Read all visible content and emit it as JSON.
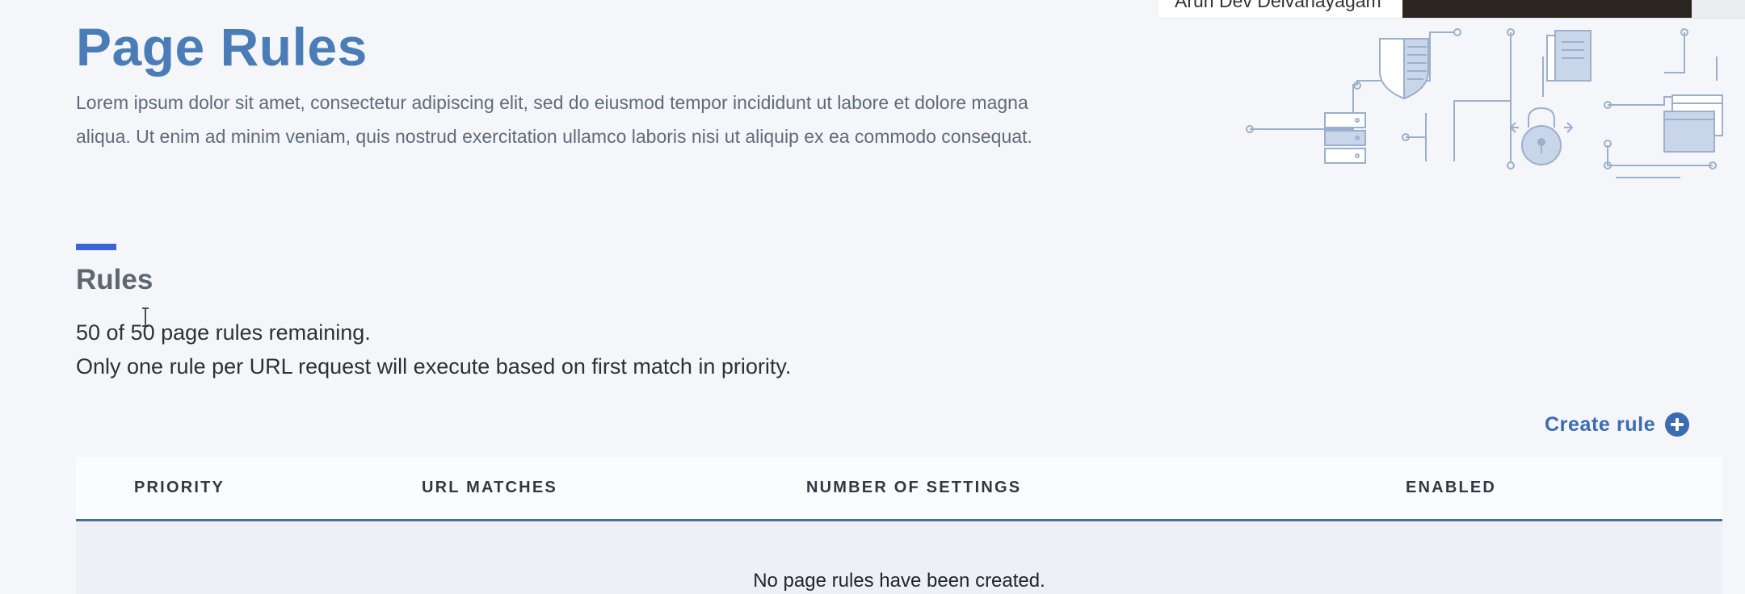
{
  "header": {
    "title": "Page Rules",
    "description": "Lorem ipsum dolor sit amet, consectetur adipiscing elit, sed do eiusmod tempor incididunt ut labore et dolore magna aliqua. Ut enim ad minim veniam, quis nostrud exercitation ullamco laboris nisi ut aliquip ex ea commodo consequat."
  },
  "rules_section": {
    "title": "Rules",
    "remaining": "50 of 50 page rules remaining.",
    "note": "Only one rule per URL request will execute based on first match in priority.",
    "create_label": "Create rule",
    "create_icon": "plus-circle-icon"
  },
  "table": {
    "columns": [
      "PRIORITY",
      "URL MATCHES",
      "NUMBER OF SETTINGS",
      "ENABLED"
    ],
    "empty_message": "No page rules have been created."
  },
  "overlay": {
    "user_name": "Arun Dev Deivanayagam"
  },
  "colors": {
    "title": "#4a7cb8",
    "accent": "#3b65d8",
    "link": "#3b6bb3",
    "header_rule": "#4a6f96",
    "illustration_stroke": "#9bb0cc",
    "illustration_fill": "#c9d6ea"
  }
}
